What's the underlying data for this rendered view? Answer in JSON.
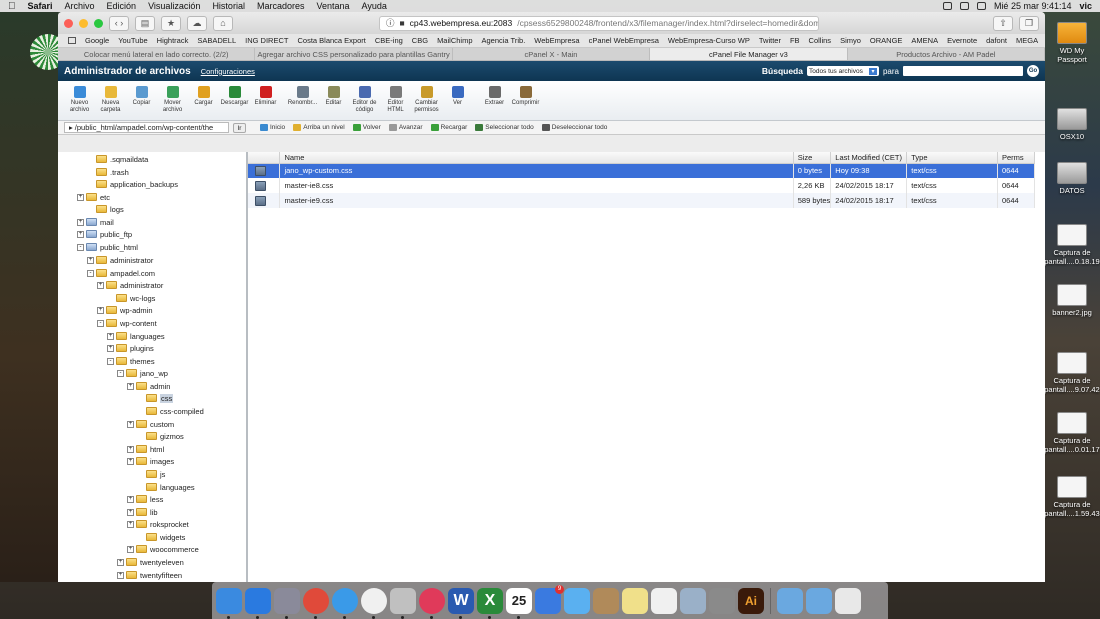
{
  "menubar": {
    "app": "Safari",
    "items": [
      "Archivo",
      "Edición",
      "Visualización",
      "Historial",
      "Marcadores",
      "Ventana",
      "Ayuda"
    ],
    "clock": "Mié 25 mar  9:41:14",
    "user": "vic"
  },
  "browser": {
    "url_host": "cp43.webempresa.eu:2083",
    "url_path": "/cpsess6529800248/frontend/x3/filemanager/index.html?dirselect=homedir&domain=",
    "bookmarks": [
      "Google",
      "YouTube",
      "Hightrack",
      "SABADELL",
      "ING DIRECT",
      "Costa Blanca Export",
      "CBE-ing",
      "CBG",
      "MailChimp",
      "Agencia Trib.",
      "WebEmpresa",
      "cPanel WebEmpresa",
      "WebEmpresa-Curso WP",
      "Twitter",
      "FB",
      "Collins",
      "Simyo",
      "ORANGE",
      "AMENA",
      "Evernote",
      "dafont",
      "MEGA"
    ],
    "tabs": [
      {
        "label": "Colocar menú lateral en lado correcto. (2/2)",
        "active": false
      },
      {
        "label": "Agregar archivo CSS personalizado para plantillas Gantry",
        "active": false
      },
      {
        "label": "cPanel X - Main",
        "active": false
      },
      {
        "label": "cPanel File Manager v3",
        "active": true
      },
      {
        "label": "Productos Archivo - AM Padel",
        "active": false
      }
    ]
  },
  "cpanel": {
    "title": "Administrador de archivos",
    "config_link": "Configuraciones",
    "search_label": "Búsqueda",
    "search_scope": "Todos tus archivos",
    "search_for": "para",
    "search_go": "Go"
  },
  "tools": [
    {
      "label": "Nuevo archivo",
      "color": "#3a8bd8"
    },
    {
      "label": "Nueva carpeta",
      "color": "#e8b83a"
    },
    {
      "label": "Copiar",
      "color": "#5a9ad0"
    },
    {
      "label": "Mover archivo",
      "color": "#3aa05a"
    },
    {
      "label": "Cargar",
      "color": "#e0a020"
    },
    {
      "label": "Descargar",
      "color": "#2a8a3a"
    },
    {
      "label": "Eliminar",
      "color": "#d02020"
    },
    {
      "label": "Renombr...",
      "color": "#6a7a8a"
    },
    {
      "label": "Editar",
      "color": "#8a8a5a"
    },
    {
      "label": "Editor de código",
      "color": "#4a6ab0"
    },
    {
      "label": "Editor HTML",
      "color": "#7a7a7a"
    },
    {
      "label": "Cambiar permisos",
      "color": "#c89a2a"
    },
    {
      "label": "Ver",
      "color": "#3a6ac0"
    },
    {
      "label": "Extraer",
      "color": "#6a6a6a"
    },
    {
      "label": "Comprimir",
      "color": "#8a6a3a"
    }
  ],
  "pathbar": {
    "path": "/public_html/ampadel.com/wp-content/the",
    "go": "Ir"
  },
  "navactions": [
    {
      "label": "Inicio",
      "color": "#3a8ad0"
    },
    {
      "label": "Arriba un nivel",
      "color": "#e0b030"
    },
    {
      "label": "Volver",
      "color": "#3aa03a"
    },
    {
      "label": "Avanzar",
      "color": "#999999"
    },
    {
      "label": "Recargar",
      "color": "#3aa03a"
    },
    {
      "label": "Seleccionar todo",
      "color": "#3a7a3a"
    },
    {
      "label": "Deseleccionar todo",
      "color": "#555555"
    }
  ],
  "tree": [
    {
      "label": ".sqmaildata",
      "exp": ""
    },
    {
      "label": ".trash",
      "exp": ""
    },
    {
      "label": "application_backups",
      "exp": ""
    },
    {
      "label": "etc",
      "exp": "+"
    },
    {
      "label": "logs",
      "exp": ""
    },
    {
      "label": "mail",
      "exp": "+"
    },
    {
      "label": "public_ftp",
      "exp": "+"
    },
    {
      "label": "public_html",
      "exp": "-"
    },
    {
      "label": "administrator",
      "exp": "+"
    },
    {
      "label": "ampadel.com",
      "exp": "-"
    },
    {
      "label": "administrator",
      "exp": "+"
    },
    {
      "label": "wc-logs",
      "exp": ""
    },
    {
      "label": "wp-admin",
      "exp": "+"
    },
    {
      "label": "wp-content",
      "exp": "-"
    },
    {
      "label": "languages",
      "exp": "+"
    },
    {
      "label": "plugins",
      "exp": "+"
    },
    {
      "label": "themes",
      "exp": "-"
    },
    {
      "label": "jano_wp",
      "exp": "-"
    },
    {
      "label": "admin",
      "exp": "+"
    },
    {
      "label": "css",
      "exp": ""
    },
    {
      "label": "css-compiled",
      "exp": ""
    },
    {
      "label": "custom",
      "exp": "+"
    },
    {
      "label": "gizmos",
      "exp": ""
    },
    {
      "label": "html",
      "exp": "+"
    },
    {
      "label": "images",
      "exp": "+"
    },
    {
      "label": "js",
      "exp": ""
    },
    {
      "label": "languages",
      "exp": ""
    },
    {
      "label": "less",
      "exp": "+"
    },
    {
      "label": "lib",
      "exp": "+"
    },
    {
      "label": "roksprocket",
      "exp": "+"
    },
    {
      "label": "widgets",
      "exp": ""
    },
    {
      "label": "woocommerce",
      "exp": "+"
    },
    {
      "label": "twentyeleven",
      "exp": "+"
    },
    {
      "label": "twentyfifteen",
      "exp": "+"
    },
    {
      "label": "twentyfourteen",
      "exp": "+"
    }
  ],
  "table": {
    "headers": [
      "",
      "Name",
      "Size",
      "Last Modified (CET)",
      "Type",
      "Perms"
    ],
    "rows": [
      {
        "name": "jano_wp-custom.css",
        "size": "0 bytes",
        "modified": "Hoy 09:38",
        "type": "text/css",
        "perms": "0644",
        "selected": true
      },
      {
        "name": "master-ie8.css",
        "size": "2,26 KB",
        "modified": "24/02/2015 18:17",
        "type": "text/css",
        "perms": "0644",
        "selected": false
      },
      {
        "name": "master-ie9.css",
        "size": "589 bytes",
        "modified": "24/02/2015 18:17",
        "type": "text/css",
        "perms": "0644",
        "selected": false
      }
    ]
  },
  "desktop": [
    {
      "label": "WD My Passport",
      "kind": "orange"
    },
    {
      "label": "OSX10",
      "kind": "disk"
    },
    {
      "label": "DATOS",
      "kind": "disk"
    },
    {
      "label": "Captura de pantall....0.18.19",
      "kind": "shot"
    },
    {
      "label": "banner2.jpg",
      "kind": "shot"
    },
    {
      "label": "Captura de pantall....9.07.42",
      "kind": "shot"
    },
    {
      "label": "Captura de pantall....0.01.17",
      "kind": "shot"
    },
    {
      "label": "Captura de pantall....1.59.43",
      "kind": "shot"
    }
  ],
  "dock": {
    "calendar_day": "25",
    "calendar_month": "MAR",
    "reminders_badge": "9",
    "illustrator": "Ai",
    "apps": [
      {
        "name": "finder-icon",
        "color": "#3a8ae0"
      },
      {
        "name": "app-store-icon",
        "color": "#2a7ae0"
      },
      {
        "name": "launchpad-icon",
        "color": "#8a8a9a"
      },
      {
        "name": "chrome-icon",
        "color": "#e04a3a"
      },
      {
        "name": "safari-icon",
        "color": "#3a9ae8"
      },
      {
        "name": "clock-icon",
        "color": "#f0f0f0"
      },
      {
        "name": "photo-booth-icon",
        "color": "#c0c0c0"
      },
      {
        "name": "itunes-icon",
        "color": "#e03a5a"
      },
      {
        "name": "word-icon",
        "color": "#2a5ab0"
      },
      {
        "name": "excel-icon",
        "color": "#2a8a3a"
      },
      {
        "name": "calendar-icon",
        "color": "#ffffff"
      },
      {
        "name": "reminders-icon",
        "color": "#3a7ae0"
      },
      {
        "name": "messages-icon",
        "color": "#5ab0f0"
      },
      {
        "name": "contacts-icon",
        "color": "#b08a5a"
      },
      {
        "name": "notes-icon",
        "color": "#f0e08a"
      },
      {
        "name": "stickies-icon",
        "color": "#f0f0f0"
      },
      {
        "name": "preview-icon",
        "color": "#9ab0c8"
      },
      {
        "name": "system-preferences-icon",
        "color": "#8a8a8a"
      },
      {
        "name": "illustrator-icon",
        "color": "#3a1a0a"
      }
    ]
  }
}
